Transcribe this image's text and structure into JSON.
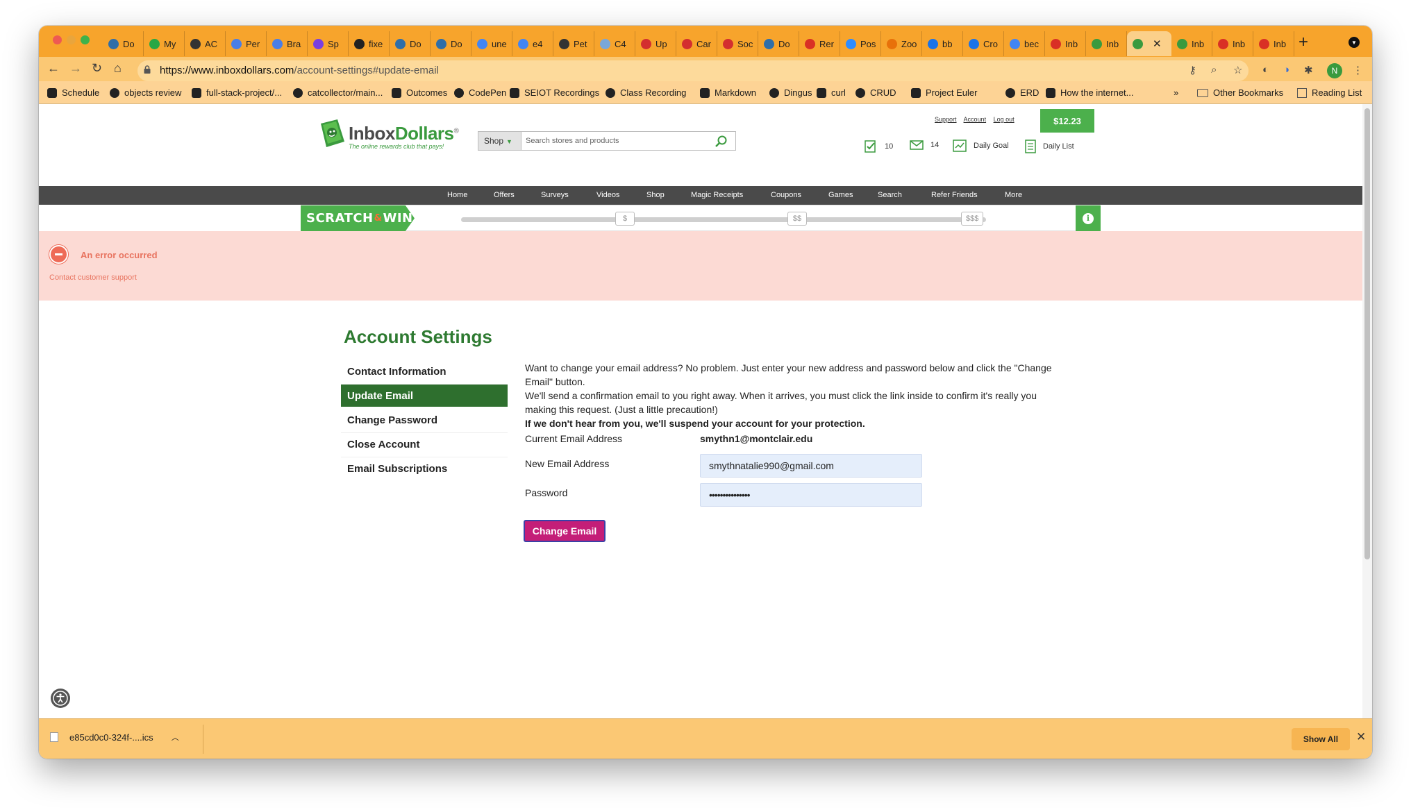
{
  "browser": {
    "tabs": [
      {
        "label": "Do",
        "color": "#2f6ea8"
      },
      {
        "label": "My",
        "color": "#27a745"
      },
      {
        "label": "AC",
        "color": "#333333"
      },
      {
        "label": "Per",
        "color": "#4a7ee6"
      },
      {
        "label": "Bra",
        "color": "#4a7ee6"
      },
      {
        "label": "Sp",
        "color": "#7a3fe0"
      },
      {
        "label": "fixe",
        "color": "#222222"
      },
      {
        "label": "Do",
        "color": "#2f6ea8"
      },
      {
        "label": "Do",
        "color": "#2f6ea8"
      },
      {
        "label": "une",
        "color": "#4285f4"
      },
      {
        "label": "e4",
        "color": "#4285f4"
      },
      {
        "label": "Pet",
        "color": "#333333"
      },
      {
        "label": "C4",
        "color": "#7aa7d8"
      },
      {
        "label": "Up",
        "color": "#d32f2f"
      },
      {
        "label": "Car",
        "color": "#d32f2f"
      },
      {
        "label": "Soc",
        "color": "#d32f2f"
      },
      {
        "label": "Do",
        "color": "#2f6ea8"
      },
      {
        "label": "Rer",
        "color": "#d93025"
      },
      {
        "label": "Pos",
        "color": "#2d8cff"
      },
      {
        "label": "Zoo",
        "color": "#e8710a"
      },
      {
        "label": "bb",
        "color": "#1a73e8"
      },
      {
        "label": "Cro",
        "color": "#1a73e8"
      },
      {
        "label": "bec",
        "color": "#4285f4"
      },
      {
        "label": "Inb",
        "color": "#d93025"
      },
      {
        "label": "Inb",
        "color": "#3a9a3e"
      },
      {
        "label": "",
        "color": "#3a9a3e",
        "active": true
      },
      {
        "label": "Inb",
        "color": "#3a9a3e"
      },
      {
        "label": "Inb",
        "color": "#d93025"
      },
      {
        "label": "Inb",
        "color": "#d93025"
      }
    ],
    "url_host": "https://www.inboxdollars.com",
    "url_path": "/account-settings#update-email",
    "profile_initial": "N",
    "bookmarks": [
      "Schedule",
      "objects review",
      "full-stack-project/...",
      "catcollector/main...",
      "Outcomes",
      "CodePen",
      "SEIOT Recordings",
      "Class Recording",
      "Markdown",
      "Dingus",
      "curl",
      "CRUD",
      "Project Euler",
      "ERD",
      "How the internet..."
    ],
    "bookmarks_overflow": "»",
    "other_bookmarks": "Other Bookmarks",
    "reading_list": "Reading List"
  },
  "site": {
    "logo_main": "Inbox",
    "logo_accent": "Dollars",
    "logo_tagline": "The online rewards club that pays!",
    "search_category": "Shop",
    "search_placeholder": "Search stores and products",
    "top_links": {
      "support": "Support",
      "account": "Account",
      "logout": "Log out"
    },
    "balance": "$12.23",
    "stats": {
      "tasks_count": "10",
      "mail_count": "14",
      "daily_goal": "Daily Goal",
      "daily_list": "Daily List"
    },
    "nav": [
      "Home",
      "Offers",
      "Surveys",
      "Videos",
      "Shop",
      "Magic Receipts",
      "Coupons",
      "Games",
      "Search",
      "Refer Friends",
      "More"
    ],
    "scratch": {
      "label_a": "SCRATCH",
      "label_amp": "&",
      "label_b": "WIN",
      "marks": [
        "$",
        "$$",
        "$$$"
      ],
      "info": "i"
    }
  },
  "error": {
    "title": "An error occurred",
    "link": "Contact customer support"
  },
  "account": {
    "title": "Account Settings",
    "menu": [
      "Contact Information",
      "Update Email",
      "Change Password",
      "Close Account",
      "Email Subscriptions"
    ],
    "intro_line1": "Want to change your email address? No problem. Just enter your new address and password below and click the \"Change Email\" button.",
    "intro_line2": "We'll send a confirmation email to you right away. When it arrives, you must click the link inside to confirm it's really you making this request. (Just a little precaution!)",
    "intro_bold": "If we don't hear from you, we'll suspend your account for your protection.",
    "current_label": "Current Email Address",
    "current_value": "smythn1@montclair.edu",
    "new_label": "New Email Address",
    "new_value": "smythnatalie990@gmail.com",
    "password_label": "Password",
    "password_value": "•••••••••••••••",
    "button": "Change Email"
  },
  "download": {
    "file": "e85cd0c0-324f-....ics",
    "show_all": "Show All"
  }
}
